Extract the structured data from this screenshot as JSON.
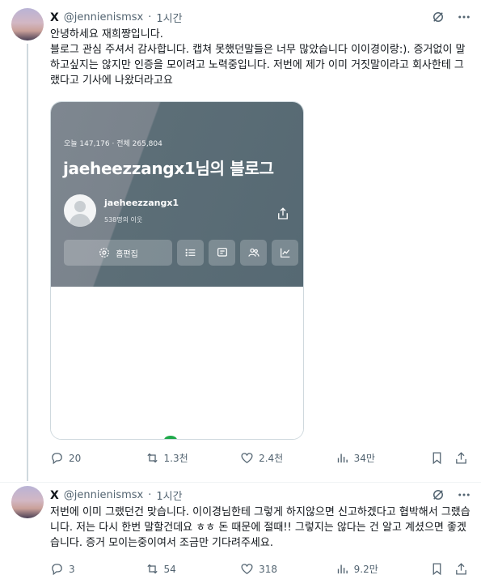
{
  "tweets": [
    {
      "name": "X",
      "handle": "@jennienismsx",
      "sep": "·",
      "time": "1시간",
      "text": "안녕하세요 재희쨩입니다.\n블로그 관심 주셔서 감사합니다. 캡쳐 못했던말들은 너무 많았습니다 이이경이랑:). 증거없이 말하고싶지는 않지만 인증을 모이려고 노력중입니다. 저번에 제가 이미 거짓말이라고 회사한테 그랬다고 기사에 나왔더라고요",
      "card": {
        "visits": "오늘 147,176 · 전체 265,804",
        "blog_title": "jaeheezzangx1님의 블로그",
        "username": "jaeheezzangx1",
        "neighbors": "538명의 이웃",
        "edit_label": "홈편집"
      },
      "stats": {
        "replies": "20",
        "retweets": "1.3천",
        "likes": "2.4천",
        "views": "34만"
      }
    },
    {
      "name": "X",
      "handle": "@jennienismsx",
      "sep": "·",
      "time": "1시간",
      "text": "저번에 이미 그랬던건 맞습니다. 이이경님한테 그렇게 하지않으면 신고하겠다고 협박해서 그랬습니다. 저는 다시 한번 말할건데요 ㅎㅎ 돈 때문에 절때!! 그렇지는 않다는 건 알고 계셨으면 좋겠습니다. 증거 모이는중이여서 조금만 기다려주세요.",
      "stats": {
        "replies": "3",
        "retweets": "54",
        "likes": "318",
        "views": "9.2만"
      }
    }
  ],
  "icons": [
    "grok-icon",
    "more-icon",
    "reply-icon",
    "retweet-icon",
    "like-icon",
    "views-icon",
    "bookmark-icon",
    "share-icon"
  ],
  "colors": {
    "text": "#0f1419",
    "muted": "#536471",
    "line": "#cfd9de"
  }
}
